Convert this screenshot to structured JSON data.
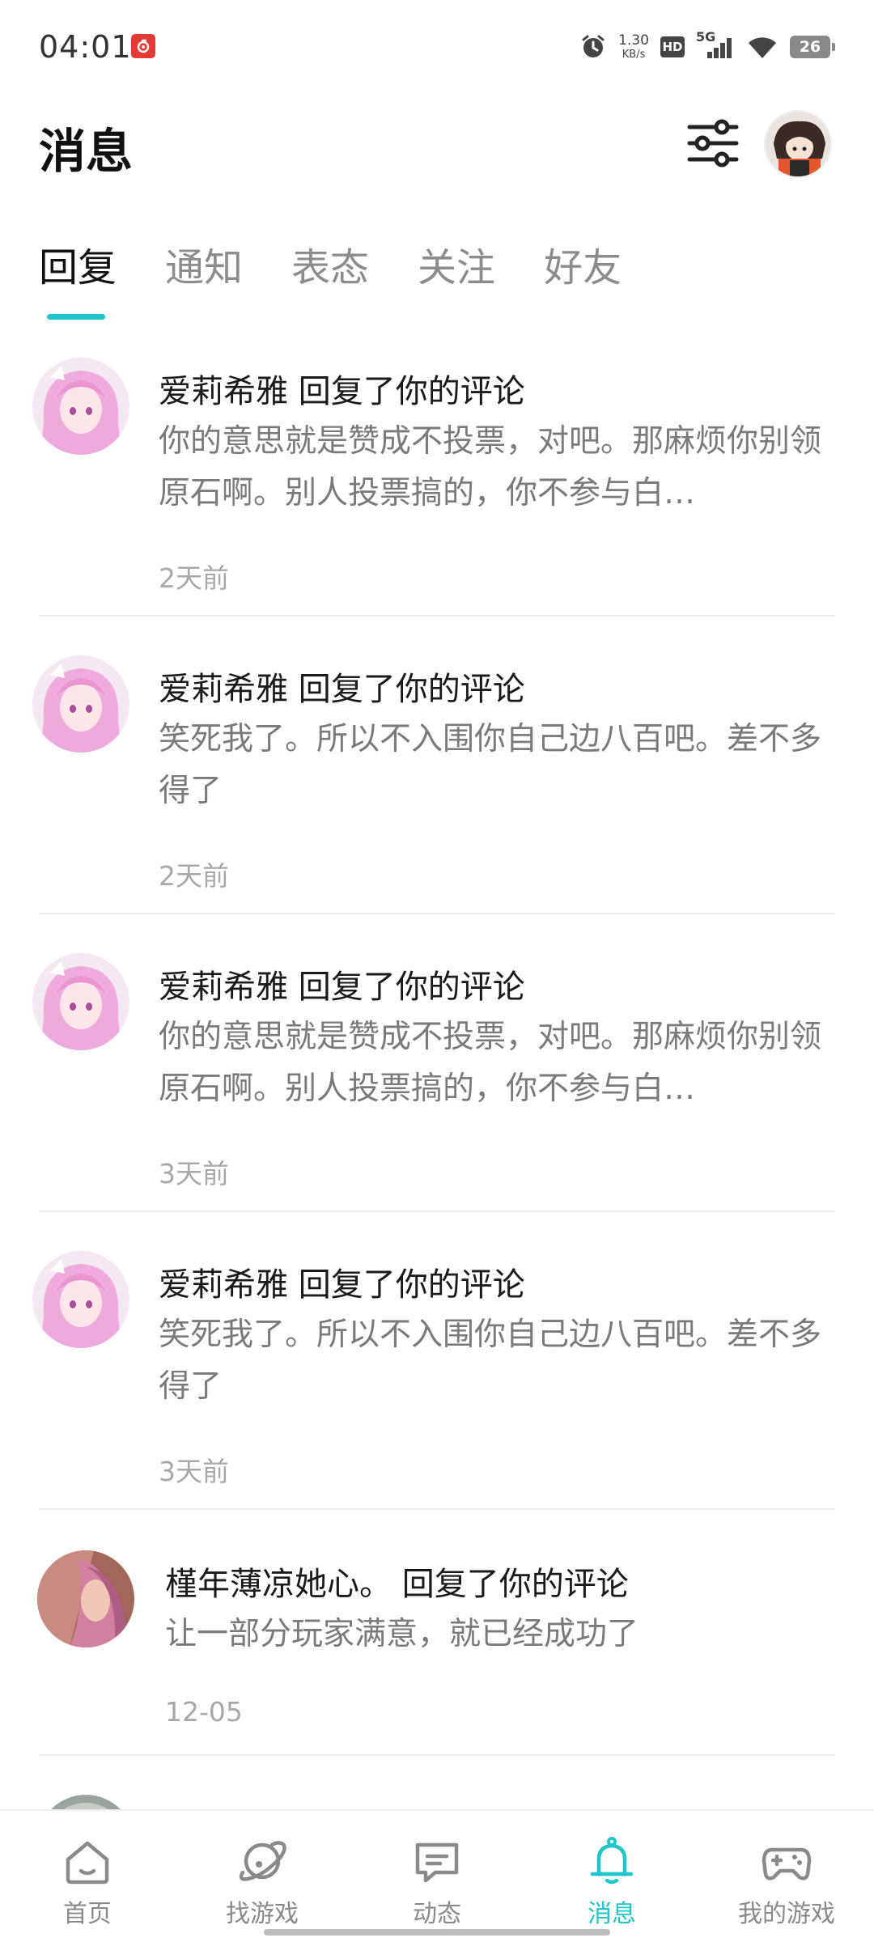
{
  "status_bar": {
    "time": "04:01",
    "net_speed_value": "1.30",
    "net_speed_unit": "KB/s",
    "hd_label": "HD",
    "network_label": "5G",
    "battery": "26"
  },
  "header": {
    "title": "消息",
    "filter_icon": "sliders-icon",
    "profile_icon": "avatar"
  },
  "tabs": [
    {
      "label": "回复",
      "active": true
    },
    {
      "label": "通知",
      "active": false
    },
    {
      "label": "表态",
      "active": false
    },
    {
      "label": "关注",
      "active": false
    },
    {
      "label": "好友",
      "active": false
    }
  ],
  "messages": [
    {
      "title": "爱莉希雅 回复了你的评论",
      "text": "你的意思就是赞成不投票，对吧。那麻烦你别领原石啊。别人投票搞的，你不参与白…",
      "time": "2天前"
    },
    {
      "title": "爱莉希雅 回复了你的评论",
      "text": "笑死我了。所以不入围你自己边八百吧。差不多得了",
      "time": "2天前"
    },
    {
      "title": "爱莉希雅 回复了你的评论",
      "text": "你的意思就是赞成不投票，对吧。那麻烦你别领原石啊。别人投票搞的，你不参与白…",
      "time": "3天前"
    },
    {
      "title": "爱莉希雅 回复了你的评论",
      "text": "笑死我了。所以不入围你自己边八百吧。差不多得了",
      "time": "3天前"
    },
    {
      "title": "槿年薄凉她心。 回复了你的评论",
      "text": "让一部分玩家满意，就已经成功了",
      "time": "12-05"
    }
  ],
  "bottom_nav": [
    {
      "label": "首页",
      "icon": "home-icon",
      "active": false
    },
    {
      "label": "找游戏",
      "icon": "planet-icon",
      "active": false
    },
    {
      "label": "动态",
      "icon": "chat-icon",
      "active": false
    },
    {
      "label": "消息",
      "icon": "bell-icon",
      "active": true
    },
    {
      "label": "我的游戏",
      "icon": "gamepad-icon",
      "active": false
    }
  ],
  "colors": {
    "accent": "#1fc5c8",
    "text_primary": "#1a1a1a",
    "text_secondary": "#7a7a7a",
    "text_muted": "#a8a8a8"
  }
}
